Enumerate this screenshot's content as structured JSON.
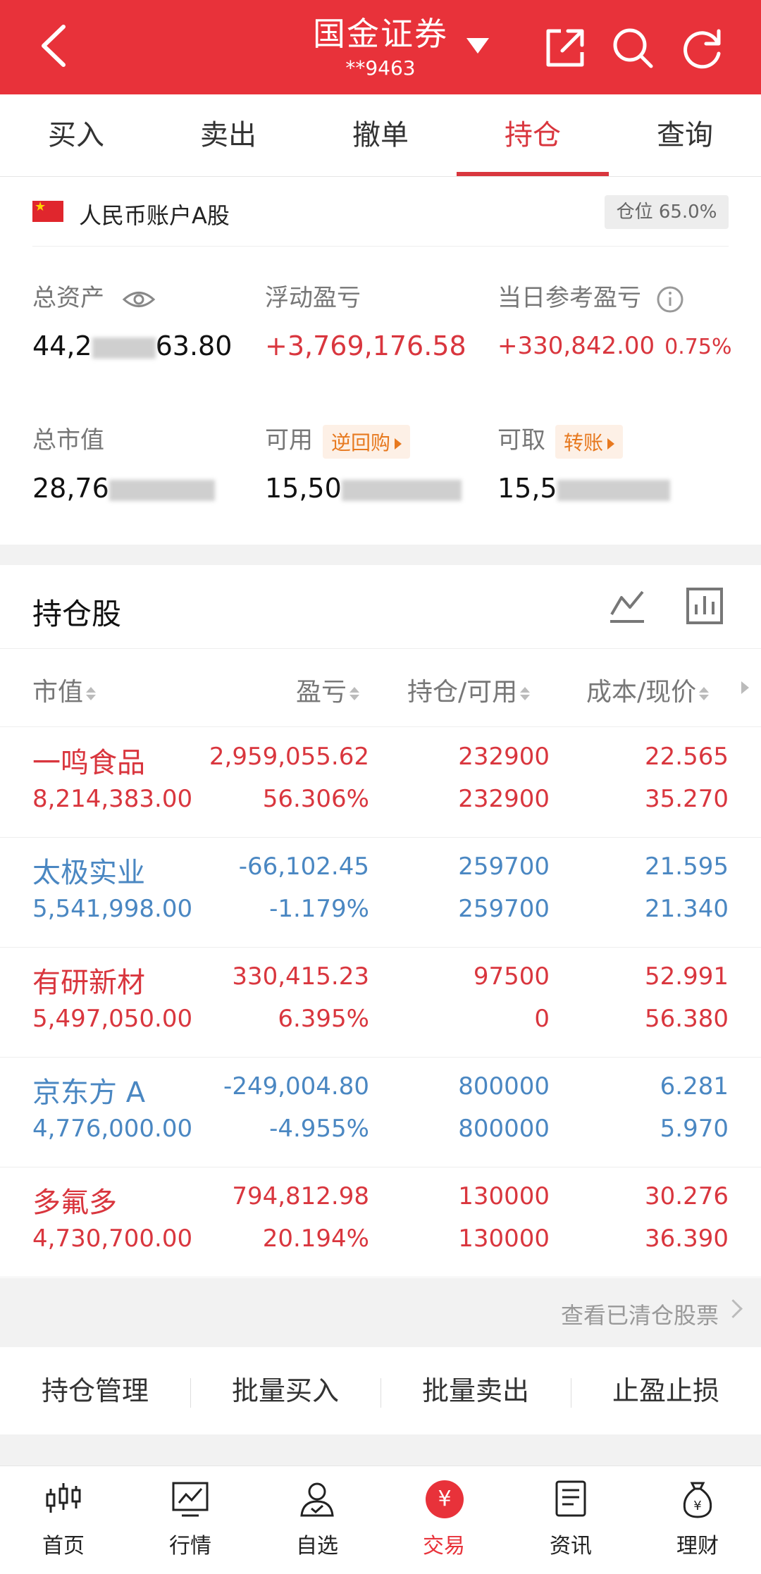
{
  "header": {
    "title": "国金证券",
    "account_masked": "**9463"
  },
  "tabs": [
    {
      "label": "买入"
    },
    {
      "label": "卖出"
    },
    {
      "label": "撤单"
    },
    {
      "label": "持仓",
      "active": true
    },
    {
      "label": "查询"
    }
  ],
  "account": {
    "label": "人民币账户A股",
    "position_ratio": "仓位 65.0%",
    "total_assets_label": "总资产",
    "total_assets_value": "44,2",
    "total_assets_tail": "63.80",
    "floating_pl_label": "浮动盈亏",
    "floating_pl_value": "+3,769,176.58",
    "today_pl_label": "当日参考盈亏",
    "today_pl_value": "+330,842.00",
    "today_pl_pct": "0.75%",
    "market_value_label": "总市值",
    "market_value_value": "28,76",
    "available_label": "可用",
    "available_value": "15,50",
    "reverse_repo_label": "逆回购",
    "withdrawable_label": "可取",
    "withdrawable_value": "15,5",
    "transfer_label": "转账"
  },
  "holdings": {
    "title": "持仓股",
    "columns": [
      "市值",
      "盈亏",
      "持仓/可用",
      "成本/现价"
    ],
    "rows": [
      {
        "name": "一鸣食品",
        "market_value": "8,214,383.00",
        "pl": "2,959,055.62",
        "pl_pct": "56.306%",
        "position": "232900",
        "available": "232900",
        "cost": "22.565",
        "price": "35.270",
        "trend": "up"
      },
      {
        "name": "太极实业",
        "market_value": "5,541,998.00",
        "pl": "-66,102.45",
        "pl_pct": "-1.179%",
        "position": "259700",
        "available": "259700",
        "cost": "21.595",
        "price": "21.340",
        "trend": "down"
      },
      {
        "name": "有研新材",
        "market_value": "5,497,050.00",
        "pl": "330,415.23",
        "pl_pct": "6.395%",
        "position": "97500",
        "available": "0",
        "cost": "52.991",
        "price": "56.380",
        "trend": "up"
      },
      {
        "name": "京东方 A",
        "market_value": "4,776,000.00",
        "pl": "-249,004.80",
        "pl_pct": "-4.955%",
        "position": "800000",
        "available": "800000",
        "cost": "6.281",
        "price": "5.970",
        "trend": "down"
      },
      {
        "name": "多氟多",
        "market_value": "4,730,700.00",
        "pl": "794,812.98",
        "pl_pct": "20.194%",
        "position": "130000",
        "available": "130000",
        "cost": "30.276",
        "price": "36.390",
        "trend": "up"
      }
    ]
  },
  "cleared_link": "查看已清仓股票",
  "actions": [
    "持仓管理",
    "批量买入",
    "批量卖出",
    "止盈止损"
  ],
  "nav": [
    {
      "label": "首页",
      "icon": "candlestick-icon"
    },
    {
      "label": "行情",
      "icon": "chart-icon"
    },
    {
      "label": "自选",
      "icon": "user-check-icon"
    },
    {
      "label": "交易",
      "icon": "yuan-icon",
      "active": true
    },
    {
      "label": "资讯",
      "icon": "document-icon"
    },
    {
      "label": "理财",
      "icon": "moneybag-icon"
    }
  ],
  "colors": {
    "brand": "#e8323a",
    "up": "#d9363e",
    "down": "#4a87c2",
    "orange": "#e7791f"
  }
}
